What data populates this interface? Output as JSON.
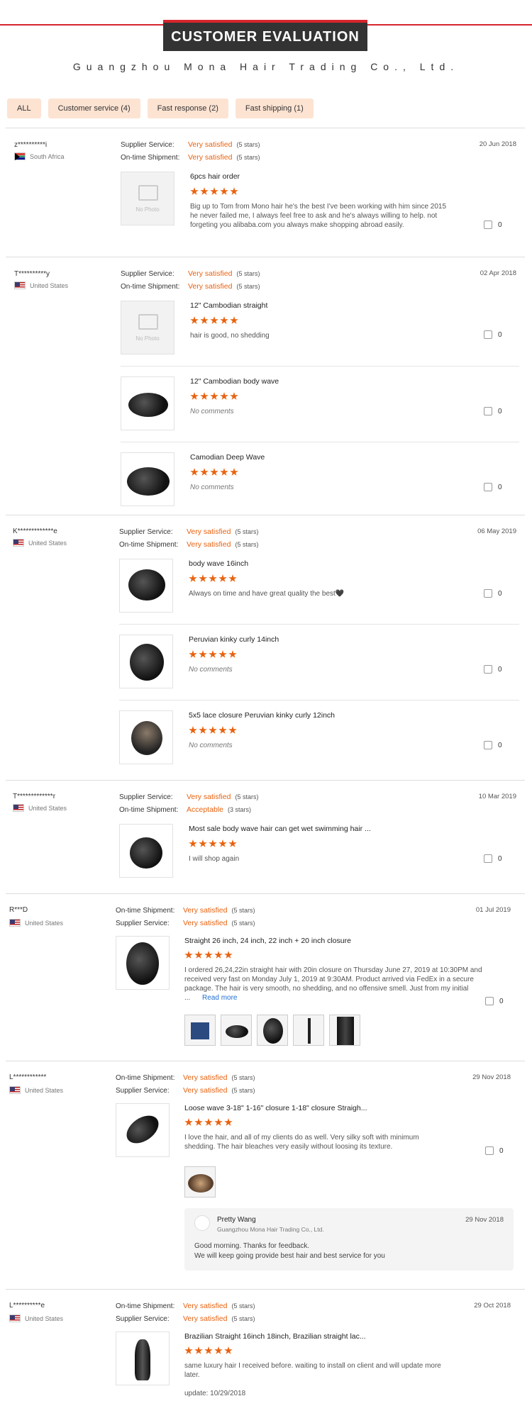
{
  "header": {
    "banner": "CUSTOMER EVALUATION",
    "company": "Guangzhou Mona Hair Trading Co., Ltd."
  },
  "colors": {
    "accent": "#d7262e",
    "rating": "#e8620f",
    "filter_bg": "#fde3d2"
  },
  "filters": [
    "ALL",
    "Customer service (4)",
    "Fast response (2)",
    "Fast shipping (1)"
  ],
  "no_photo": "No Photo",
  "labels": {
    "supplier": "Supplier Service:",
    "ontime": "On-time Shipment:",
    "read_more": "Read more"
  },
  "reviews": [
    {
      "user": "z**********i",
      "country": "South Africa",
      "date": "20 Jun 2018",
      "r1": {
        "label": "Supplier Service:",
        "value": "Very satisfied",
        "stars": "(5 stars)"
      },
      "r2": {
        "label": "On-time Shipment:",
        "value": "Very satisfied",
        "stars": "(5 stars)"
      },
      "items": [
        {
          "name": "6pcs hair order",
          "comment": "Big up to Tom from Mono hair he's the best I've been working with him since 2015 he never failed me, I always feel free to ask and he's always willing to help. not forgeting you alibaba.com you always make shopping abroad easily.",
          "likes": "0"
        }
      ]
    },
    {
      "user": "T**********y",
      "country": "United States",
      "date": "02 Apr 2018",
      "r1": {
        "label": "Supplier Service:",
        "value": "Very satisfied",
        "stars": "(5 stars)"
      },
      "r2": {
        "label": "On-time Shipment:",
        "value": "Very satisfied",
        "stars": "(5 stars)"
      },
      "items": [
        {
          "name": "12\" Cambodian straight",
          "comment": "hair is good, no shedding",
          "likes": "0"
        },
        {
          "name": "12\" Cambodian body wave",
          "comment": "No comments",
          "likes": "0"
        },
        {
          "name": "Camodian Deep Wave",
          "comment": "No comments",
          "likes": "0"
        }
      ]
    },
    {
      "user": "K*************e",
      "country": "United States",
      "date": "06 May 2019",
      "r1": {
        "label": "Supplier Service:",
        "value": "Very satisfied",
        "stars": "(5 stars)"
      },
      "r2": {
        "label": "On-time Shipment:",
        "value": "Very satisfied",
        "stars": "(5 stars)"
      },
      "items": [
        {
          "name": "body wave 16inch",
          "comment": "Always on time and have great quality the best🖤",
          "likes": "0"
        },
        {
          "name": "Peruvian kinky curly 14inch",
          "comment": "No comments",
          "likes": "0"
        },
        {
          "name": "5x5 lace closure Peruvian kinky curly 12inch",
          "comment": "No comments",
          "likes": "0"
        }
      ]
    },
    {
      "user": "T*************r",
      "country": "United States",
      "date": "10 Mar 2019",
      "r1": {
        "label": "Supplier Service:",
        "value": "Very satisfied",
        "stars": "(5 stars)"
      },
      "r2": {
        "label": "On-time Shipment:",
        "value": "Acceptable",
        "stars": "(3 stars)"
      },
      "items": [
        {
          "name": "Most sale body wave hair can get wet swimming hair ...",
          "comment": "I will shop again",
          "likes": "0"
        }
      ]
    },
    {
      "user": "R***D",
      "country": "United States",
      "date": "01 Jul 2019",
      "r1": {
        "label": "On-time Shipment:",
        "value": "Very satisfied",
        "stars": "(5 stars)"
      },
      "r2": {
        "label": "Supplier Service:",
        "value": "Very satisfied",
        "stars": "(5 stars)"
      },
      "items": [
        {
          "name": "Straight 26 inch, 24 inch, 22 inch + 20 inch closure",
          "comment": "I ordered 26,24,22in straight hair with 20in closure on Thursday June 27, 2019 at 10:30PM and received very fast on Monday July 1, 2019 at 9:30AM.  Product arrived via FedEx in a secure package.  The hair is very smooth, no shedding, and no offensive smell.  Just from my initial ...",
          "likes": "0"
        }
      ]
    },
    {
      "user": "L************",
      "country": "United States",
      "date": "29 Nov 2018",
      "r1": {
        "label": "On-time Shipment:",
        "value": "Very satisfied",
        "stars": "(5 stars)"
      },
      "r2": {
        "label": "Supplier Service:",
        "value": "Very satisfied",
        "stars": "(5 stars)"
      },
      "items": [
        {
          "name": "Loose wave 3-18\" 1-16\" closure 1-18\" closure Straigh...",
          "comment": "I love the hair, and all of my clients do as well. Very silky soft with minimum shedding. The hair bleaches very easily without loosing its texture.",
          "likes": "0"
        }
      ],
      "reply": {
        "name": "Pretty Wang",
        "company": "Guangzhou Mona Hair Trading Co., Ltd.",
        "date": "29 Nov 2018",
        "line1": "Good morning. Thanks for feedback.",
        "line2": "We will keep going provide best hair and best service for you"
      }
    },
    {
      "user": "L**********e",
      "country": "United States",
      "date": "29 Oct 2018",
      "r1": {
        "label": "On-time Shipment:",
        "value": "Very satisfied",
        "stars": "(5 stars)"
      },
      "r2": {
        "label": "Supplier Service:",
        "value": "Very satisfied",
        "stars": "(5 stars)"
      },
      "items": [
        {
          "name": "Brazilian Straight 16inch 18inch, Brazilian straight lac...",
          "comment": "same luxury hair I received before. waiting to install on client and will update more later.",
          "update": "update: 10/29/2018",
          "likes": ""
        }
      ]
    }
  ]
}
